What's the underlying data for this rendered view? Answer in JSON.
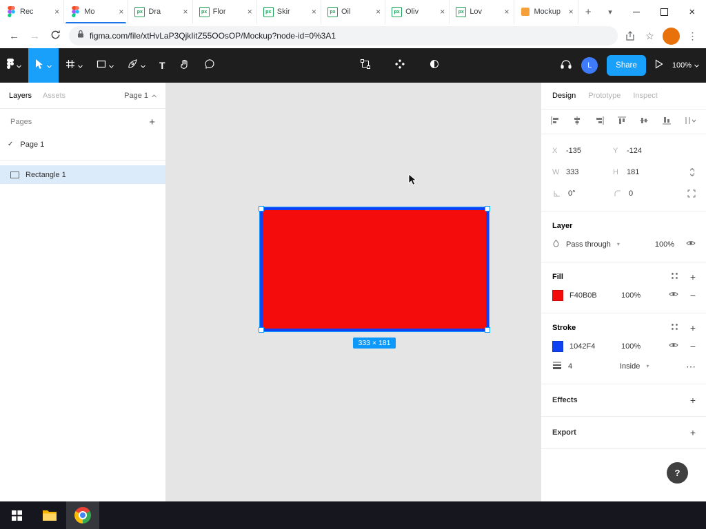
{
  "browser": {
    "tabs": [
      {
        "label": "Rec"
      },
      {
        "label": "Mo"
      },
      {
        "label": "Dra"
      },
      {
        "label": "Flor"
      },
      {
        "label": "Skir"
      },
      {
        "label": "Oil"
      },
      {
        "label": "Oliv"
      },
      {
        "label": "Lov"
      },
      {
        "label": "Mockup"
      }
    ],
    "url": "figma.com/file/xtHvLaP3QjkIitZ55OOsOP/Mockup?node-id=0%3A1"
  },
  "figma_toolbar": {
    "share": "Share",
    "zoom": "100%",
    "avatar": "L"
  },
  "left_panel": {
    "tab_layers": "Layers",
    "tab_assets": "Assets",
    "page_selector": "Page 1",
    "pages_title": "Pages",
    "page_item": "Page 1",
    "layer_item": "Rectangle 1"
  },
  "canvas": {
    "size_badge": "333 × 181"
  },
  "right_panel": {
    "tab_design": "Design",
    "tab_prototype": "Prototype",
    "tab_inspect": "Inspect",
    "x_label": "X",
    "x_value": "-135",
    "y_label": "Y",
    "y_value": "-124",
    "w_label": "W",
    "w_value": "333",
    "h_label": "H",
    "h_value": "181",
    "rotation_value": "0°",
    "radius_value": "0",
    "layer_title": "Layer",
    "blend_mode": "Pass through",
    "layer_opacity": "100%",
    "fill_title": "Fill",
    "fill_hex": "F40B0B",
    "fill_opacity": "100%",
    "stroke_title": "Stroke",
    "stroke_hex": "1042F4",
    "stroke_opacity": "100%",
    "stroke_weight": "4",
    "stroke_align": "Inside",
    "effects_title": "Effects",
    "export_title": "Export",
    "help_label": "?"
  },
  "colors": {
    "fill": "#F40B0B",
    "stroke": "#1042F4",
    "selection": "#0D99FF",
    "accent": "#18A0FB"
  },
  "icons": {
    "close": "×",
    "plus": "+",
    "check": "✓",
    "kebab": "⋮",
    "star": "☆",
    "chevron_down": "▾",
    "minus": "−",
    "more": "⋯",
    "back": "←",
    "forward": "→",
    "px": "px",
    "text_tool": "T"
  }
}
